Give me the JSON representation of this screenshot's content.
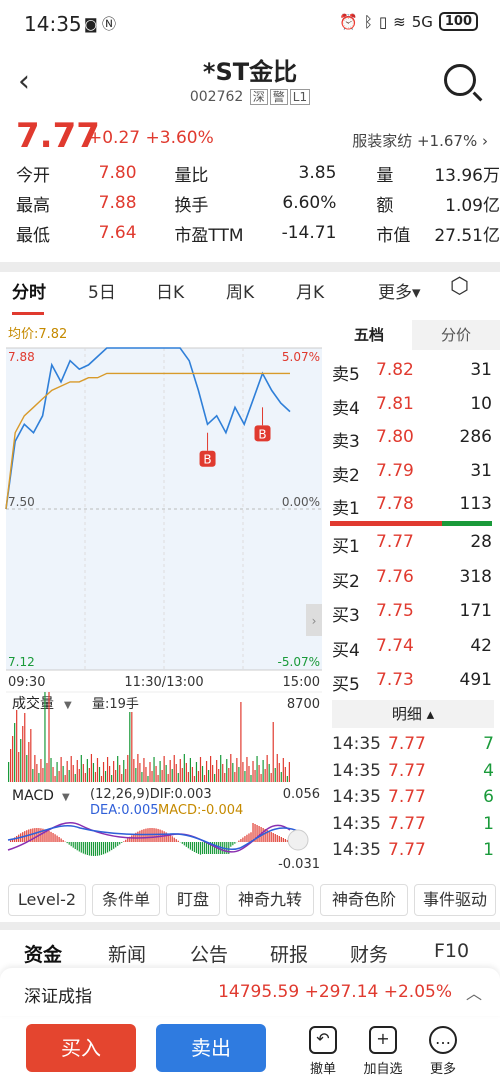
{
  "status": {
    "time": "14:35",
    "battery": "100",
    "net": "5G"
  },
  "header": {
    "title": "*ST金比",
    "code": "002762",
    "tag1": "深",
    "tag2": "警",
    "tag3": "L1"
  },
  "price": {
    "last": "7.77",
    "change": "+0.27",
    "pct": "+3.60%",
    "sector_name": "服装家纺",
    "sector_pct": "+1.67%"
  },
  "quotes": [
    [
      "今开",
      "7.80",
      "量比",
      "3.85",
      "量",
      "13.96万"
    ],
    [
      "最高",
      "7.88",
      "换手",
      "6.60%",
      "额",
      "1.09亿"
    ],
    [
      "最低",
      "7.64",
      "市盈TTM",
      "-14.71",
      "市值",
      "27.51亿"
    ]
  ],
  "tabs": [
    "分时",
    "5日",
    "日K",
    "周K",
    "月K",
    "更多"
  ],
  "chart_labels": {
    "avg": "均价:7.82",
    "high": "7.88",
    "pct_high": "5.07%",
    "mid": "7.50",
    "pct_mid": "0.00%",
    "low": "7.12",
    "pct_low": "-5.07%",
    "t_open": "09:30",
    "t_mid": "11:30/13:00",
    "t_close": "15:00",
    "vol_title": "成交量",
    "vol_val": "量:19手",
    "vol_max": "8700",
    "macd_title": "MACD",
    "macd_params": "(12,26,9)DIF:0.003",
    "dea": "DEA:0.005",
    "macd": "MACD:-0.004",
    "macd_max": "0.056",
    "macd_min": "-0.031",
    "buy_marker": "B"
  },
  "chart_data": {
    "type": "line",
    "ylim": [
      7.12,
      7.88
    ],
    "price": [
      7.5,
      7.66,
      7.7,
      7.68,
      7.72,
      7.84,
      7.8,
      7.85,
      7.83,
      7.84,
      7.86,
      7.88,
      7.88,
      7.88,
      7.88,
      7.88,
      7.88,
      7.88,
      7.88,
      7.88,
      7.85,
      7.78,
      7.7,
      7.72,
      7.68,
      7.74,
      7.7,
      7.76,
      7.82,
      7.78,
      7.75,
      7.73
    ],
    "avg": [
      7.5,
      7.68,
      7.72,
      7.74,
      7.76,
      7.78,
      7.79,
      7.8,
      7.8,
      7.81,
      7.81,
      7.82,
      7.82,
      7.82,
      7.82,
      7.82,
      7.82,
      7.82,
      7.82,
      7.82,
      7.82,
      7.82,
      7.82,
      7.82,
      7.82,
      7.82,
      7.82,
      7.82,
      7.82,
      7.82,
      7.82,
      7.82
    ]
  },
  "five": {
    "tab1": "五档",
    "tab2": "分价",
    "sell": [
      [
        "卖5",
        "7.82",
        "31"
      ],
      [
        "卖4",
        "7.81",
        "10"
      ],
      [
        "卖3",
        "7.80",
        "286"
      ],
      [
        "卖2",
        "7.79",
        "31"
      ],
      [
        "卖1",
        "7.78",
        "113"
      ]
    ],
    "buy": [
      [
        "买1",
        "7.77",
        "28"
      ],
      [
        "买2",
        "7.76",
        "318"
      ],
      [
        "买3",
        "7.75",
        "171"
      ],
      [
        "买4",
        "7.74",
        "42"
      ],
      [
        "买5",
        "7.73",
        "491"
      ]
    ],
    "detail_title": "明细",
    "detail": [
      [
        "14:35",
        "7.77",
        "7"
      ],
      [
        "14:35",
        "7.77",
        "4"
      ],
      [
        "14:35",
        "7.77",
        "6"
      ],
      [
        "14:35",
        "7.77",
        "1"
      ],
      [
        "14:35",
        "7.77",
        "1"
      ]
    ]
  },
  "features": [
    "Level-2",
    "条件单",
    "盯盘",
    "神奇九转",
    "神奇色阶",
    "事件驱动"
  ],
  "bottom_tabs": [
    "资金",
    "新闻",
    "公告",
    "研报",
    "财务",
    "F10"
  ],
  "index": {
    "name": "深证成指",
    "value": "14795.59",
    "change": "+297.14",
    "pct": "+2.05%"
  },
  "actions": {
    "buy": "买入",
    "sell": "卖出",
    "t1": "撤单",
    "t2": "加自选",
    "t3": "更多"
  }
}
